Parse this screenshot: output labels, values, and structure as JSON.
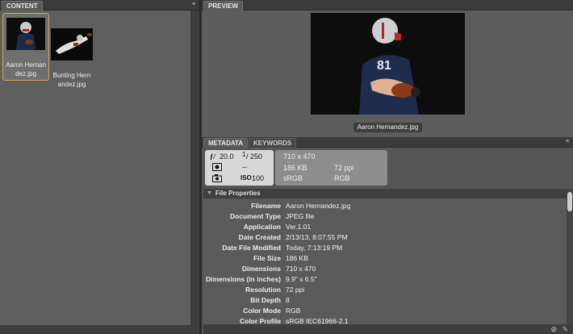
{
  "content_panel": {
    "tab_label": "CONTENT",
    "items": [
      {
        "label": "Aaron Hernandez.jpg",
        "label_line1": "Aaron Hernan",
        "label_line2": "dez.jpg",
        "selected": true
      },
      {
        "label": "Bunting Hernandez.jpg",
        "label_line1": "Bunting Hern",
        "label_line2": "andez.jpg",
        "selected": false
      }
    ]
  },
  "preview_panel": {
    "tab_label": "PREVIEW",
    "image_name": "Aaron Hernandez.jpg"
  },
  "metadata_panel": {
    "tabs": [
      "METADATA",
      "KEYWORDS"
    ],
    "exif": {
      "aperture": "20.0",
      "shutter": "250",
      "shutter_numerator": "1",
      "metering": "--",
      "iso": "100"
    },
    "info": {
      "dimensions": "710 x 470",
      "file_size": "186 KB",
      "resolution": "72 ppi",
      "color_space": "sRGB",
      "color_mode": "RGB"
    },
    "section_title": "File Properties",
    "properties": [
      {
        "key": "Filename",
        "value": "Aaron Hernandez.jpg"
      },
      {
        "key": "Document Type",
        "value": "JPEG file"
      },
      {
        "key": "Application",
        "value": "Ver.1.01"
      },
      {
        "key": "Date Created",
        "value": "2/13/13, 8:07:55 PM"
      },
      {
        "key": "Date File Modified",
        "value": "Today, 7:13:19 PM"
      },
      {
        "key": "File Size",
        "value": "186 KB"
      },
      {
        "key": "Dimensions",
        "value": "710 x 470"
      },
      {
        "key": "Dimensions (in inches)",
        "value": "9.9\" x 6.5\""
      },
      {
        "key": "Resolution",
        "value": "72 ppi"
      },
      {
        "key": "Bit Depth",
        "value": "8"
      },
      {
        "key": "Color Mode",
        "value": "RGB"
      },
      {
        "key": "Color Profile",
        "value": "sRGB IEC61966-2.1"
      }
    ]
  },
  "colors": {
    "selection_border": "#d5a55a",
    "panel_bg": "#5f5f5f",
    "tab_bar": "#3b3b3b"
  }
}
